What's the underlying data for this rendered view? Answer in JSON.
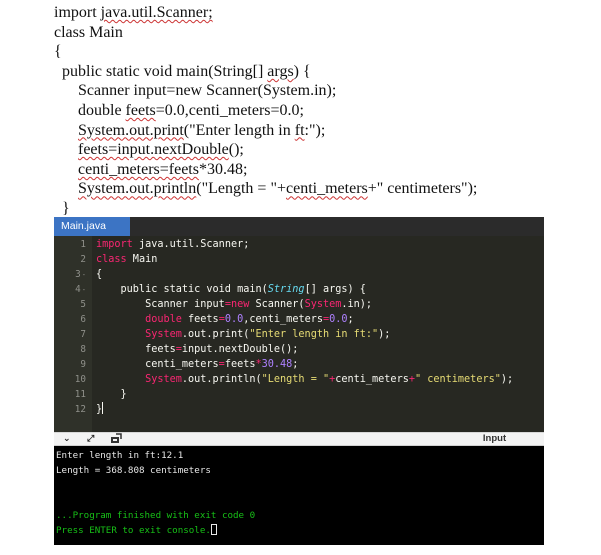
{
  "document_code": {
    "lines": [
      "import java.util.Scanner;",
      "class Main",
      "{",
      "  public static void main(String[] args) {",
      "      Scanner input=new Scanner(System.in);",
      "      double feets=0.0,centi_meters=0.0;",
      "      System.out.print(\"Enter length in ft:\");",
      "      feets=input.nextDouble();",
      "      centi_meters=feets*30.48;",
      "      System.out.println(\"Length = \"+centi_meters+\" centimeters\");",
      "  }",
      "}"
    ]
  },
  "ide": {
    "tab_label": "Main.java",
    "line_numbers": [
      "1",
      "2",
      "3",
      "4",
      "5",
      "6",
      "7",
      "8",
      "9",
      "10",
      "11",
      "12"
    ],
    "fold_markers": {
      "3": "-",
      "4": "-"
    },
    "theme_colors": {
      "background": "#272822",
      "keyword": "#f92672",
      "string": "#e6db74",
      "number": "#ae81ff",
      "type": "#66d9ef",
      "text": "#f8f8f2"
    },
    "code": {
      "l1_kw": "import",
      "l1_rest": " java.util.Scanner;",
      "l2_kw": "class",
      "l2_rest": " Main",
      "l3": "{",
      "l4_a": "    public static void main(",
      "l4_type": "String",
      "l4_b": "[] args) {",
      "l5_a": "        Scanner input",
      "l5_eq": "=",
      "l5_new": "new",
      "l5_b": " Scanner(",
      "l5_sys": "System",
      "l5_c": ".in);",
      "l6_kw": "double",
      "l6_a": " feets",
      "l6_eq1": "=",
      "l6_n1": "0.0",
      "l6_b": ",centi_meters",
      "l6_eq2": "=",
      "l6_n2": "0.0",
      "l6_c": ";",
      "l7_sys": "System",
      "l7_a": ".out.print(",
      "l7_str": "\"Enter length in ft:\"",
      "l7_b": ");",
      "l8_a": "        feets",
      "l8_eq": "=",
      "l8_b": "input.nextDouble();",
      "l9_a": "        centi_meters",
      "l9_eq": "=",
      "l9_b": "feets",
      "l9_mul": "*",
      "l9_n": "30.48",
      "l9_c": ";",
      "l10_sys": "System",
      "l10_a": ".out.println(",
      "l10_s1": "\"Length = \"",
      "l10_p1": "+",
      "l10_b": "centi_meters",
      "l10_p2": "+",
      "l10_s2": "\" centimeters\"",
      "l10_c": ");",
      "l11": "    }",
      "l12": "}"
    }
  },
  "console_toolbar": {
    "icons": [
      "chevron-down-icon",
      "expand-icon",
      "clear-console-icon"
    ],
    "input_tab_label": "Input"
  },
  "console": {
    "lines": [
      "Enter length in ft:12.1",
      "Length = 368.808 centimeters",
      "",
      "",
      "...Program finished with exit code 0",
      "Press ENTER to exit console."
    ],
    "success_color": "#17c017"
  }
}
